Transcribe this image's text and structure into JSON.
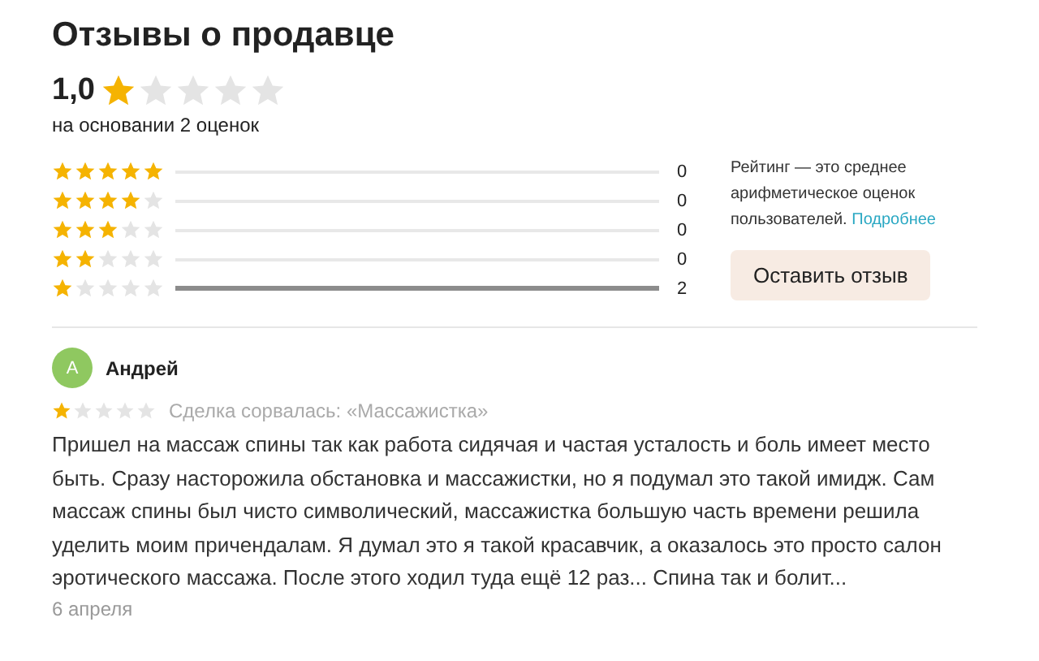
{
  "title": "Отзывы о продавце",
  "summary": {
    "rating": "1,0",
    "stars": 1,
    "basis": "на основании 2 оценок"
  },
  "histogram": [
    {
      "stars": 5,
      "level": 0,
      "count": "0"
    },
    {
      "stars": 4,
      "level": 0,
      "count": "0"
    },
    {
      "stars": 3,
      "level": 0,
      "count": "0"
    },
    {
      "stars": 2,
      "level": 0,
      "count": "0"
    },
    {
      "stars": 1,
      "level": 1,
      "count": "2"
    }
  ],
  "info": {
    "text": "Рейтинг — это среднее арифметическое оценок пользователей.",
    "link": "Подробнее"
  },
  "leave_review_button": "Оставить отзыв",
  "reviews": [
    {
      "avatar": "А",
      "author": "Андрей",
      "stars": 1,
      "deal": "Сделка сорвалась: «Массажистка»",
      "text": "Пришел на массаж спины так как работа сидячая и частая усталость и боль имеет место быть. Сразу насторожила обстановка и массажистки, но я подумал это такой имидж. Сам массаж спины был чисто символический, массажистка большую часть времени решила уделить моим причендалам. Я думал это я такой красавчик, а оказалось это просто салон эротического массажа. После этого ходил туда ещё 12 раз... Спина так и болит...",
      "date": "6 апреля"
    }
  ]
}
